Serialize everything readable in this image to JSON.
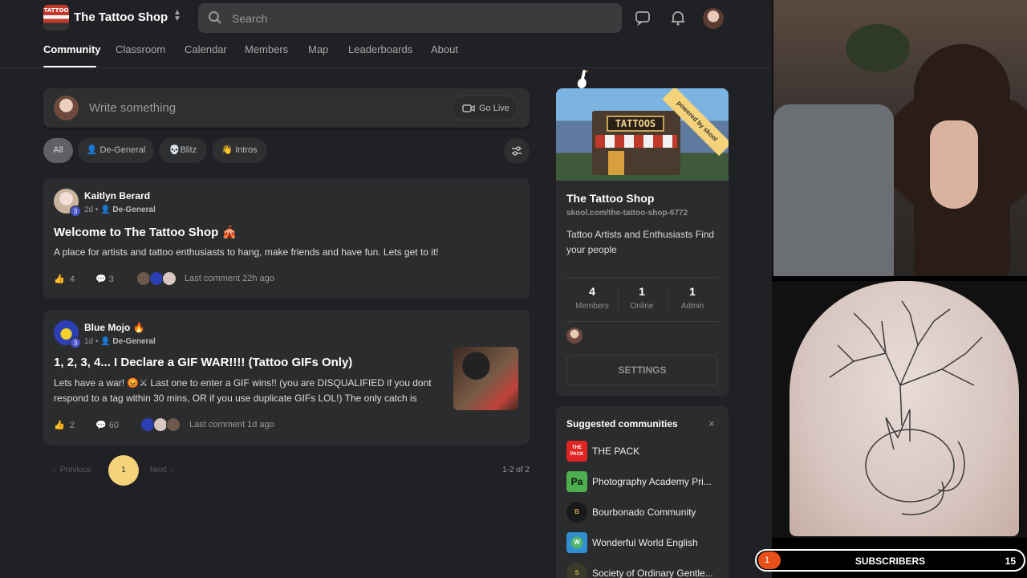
{
  "header": {
    "logo_text": "TATTOO",
    "brand": "The Tattoo Shop",
    "search_placeholder": "Search"
  },
  "tabs": [
    {
      "label": "Community",
      "active": true
    },
    {
      "label": "Classroom"
    },
    {
      "label": "Calendar"
    },
    {
      "label": "Members"
    },
    {
      "label": "Map"
    },
    {
      "label": "Leaderboards"
    },
    {
      "label": "About"
    }
  ],
  "composer": {
    "placeholder": "Write something",
    "go_live": "Go Live"
  },
  "filters": [
    {
      "label": "All",
      "active": true
    },
    {
      "label": "De-General",
      "icon": "person-icon"
    },
    {
      "label": "Blitz",
      "icon": "skull-icon"
    },
    {
      "label": "Intros",
      "icon": "wave-icon"
    }
  ],
  "posts": [
    {
      "author": "Kaitlyn Berard",
      "level": "3",
      "time": "2d",
      "category": "De-General",
      "title": "Welcome to The Tattoo Shop 🎪",
      "body": "A place for artists and tattoo enthusiasts to hang, make friends and have fun. Lets get to it!",
      "likes": "4",
      "comments": "3",
      "last_comment": "Last comment 22h ago"
    },
    {
      "author": "Blue Mojo 🔥",
      "level": "3",
      "time": "1d",
      "category": "De-General",
      "title": "1, 2, 3, 4... I Declare a GIF WAR!!!! (Tattoo GIFs Only)",
      "body": "Lets have a war! 😡⚔ Last one to enter a GIF wins!! (you are DISQUALIFIED if you dont respond to a tag within 30 mins, OR if you use duplicate GIFs LOL!) The only catch is",
      "likes": "2",
      "comments": "60",
      "last_comment": "Last comment 1d ago"
    }
  ],
  "pagination": {
    "previous": "Previous",
    "next": "Next",
    "current": "1",
    "count": "1-2 of 2"
  },
  "community_card": {
    "banner_sign": "TATTOOS",
    "ribbon": "powered by skool",
    "name": "The Tattoo Shop",
    "url": "skool.com/the-tattoo-shop-6772",
    "description": "Tattoo Artists and Enthusiasts Find your people",
    "stats": [
      {
        "value": "4",
        "label": "Members"
      },
      {
        "value": "1",
        "label": "Online"
      },
      {
        "value": "1",
        "label": "Admin"
      }
    ],
    "settings": "SETTINGS"
  },
  "suggested": {
    "heading": "Suggested communities",
    "close": "×",
    "items": [
      {
        "name": "THE PACK",
        "icon_text": "THE PACK",
        "color": "#e02424"
      },
      {
        "name": "Photography Academy Pri...",
        "icon_text": "Pa",
        "color": "#4caf50"
      },
      {
        "name": "Bourbonado Community",
        "icon_text": "B",
        "color": "#1a1a1a"
      },
      {
        "name": "Wonderful World English",
        "icon_text": "W",
        "color": "#2f8fcf"
      },
      {
        "name": "Society of Ordinary Gentle...",
        "icon_text": "S",
        "color": "#3a3a2a"
      }
    ]
  },
  "overlay": {
    "sub_badge": "1",
    "sub_label": "SUBSCRIBERS",
    "sub_count": "15"
  },
  "colors": {
    "background": "#202124",
    "card": "#2b2c2e",
    "accent": "#f4d37a",
    "level_badge": "#4a55c8"
  }
}
